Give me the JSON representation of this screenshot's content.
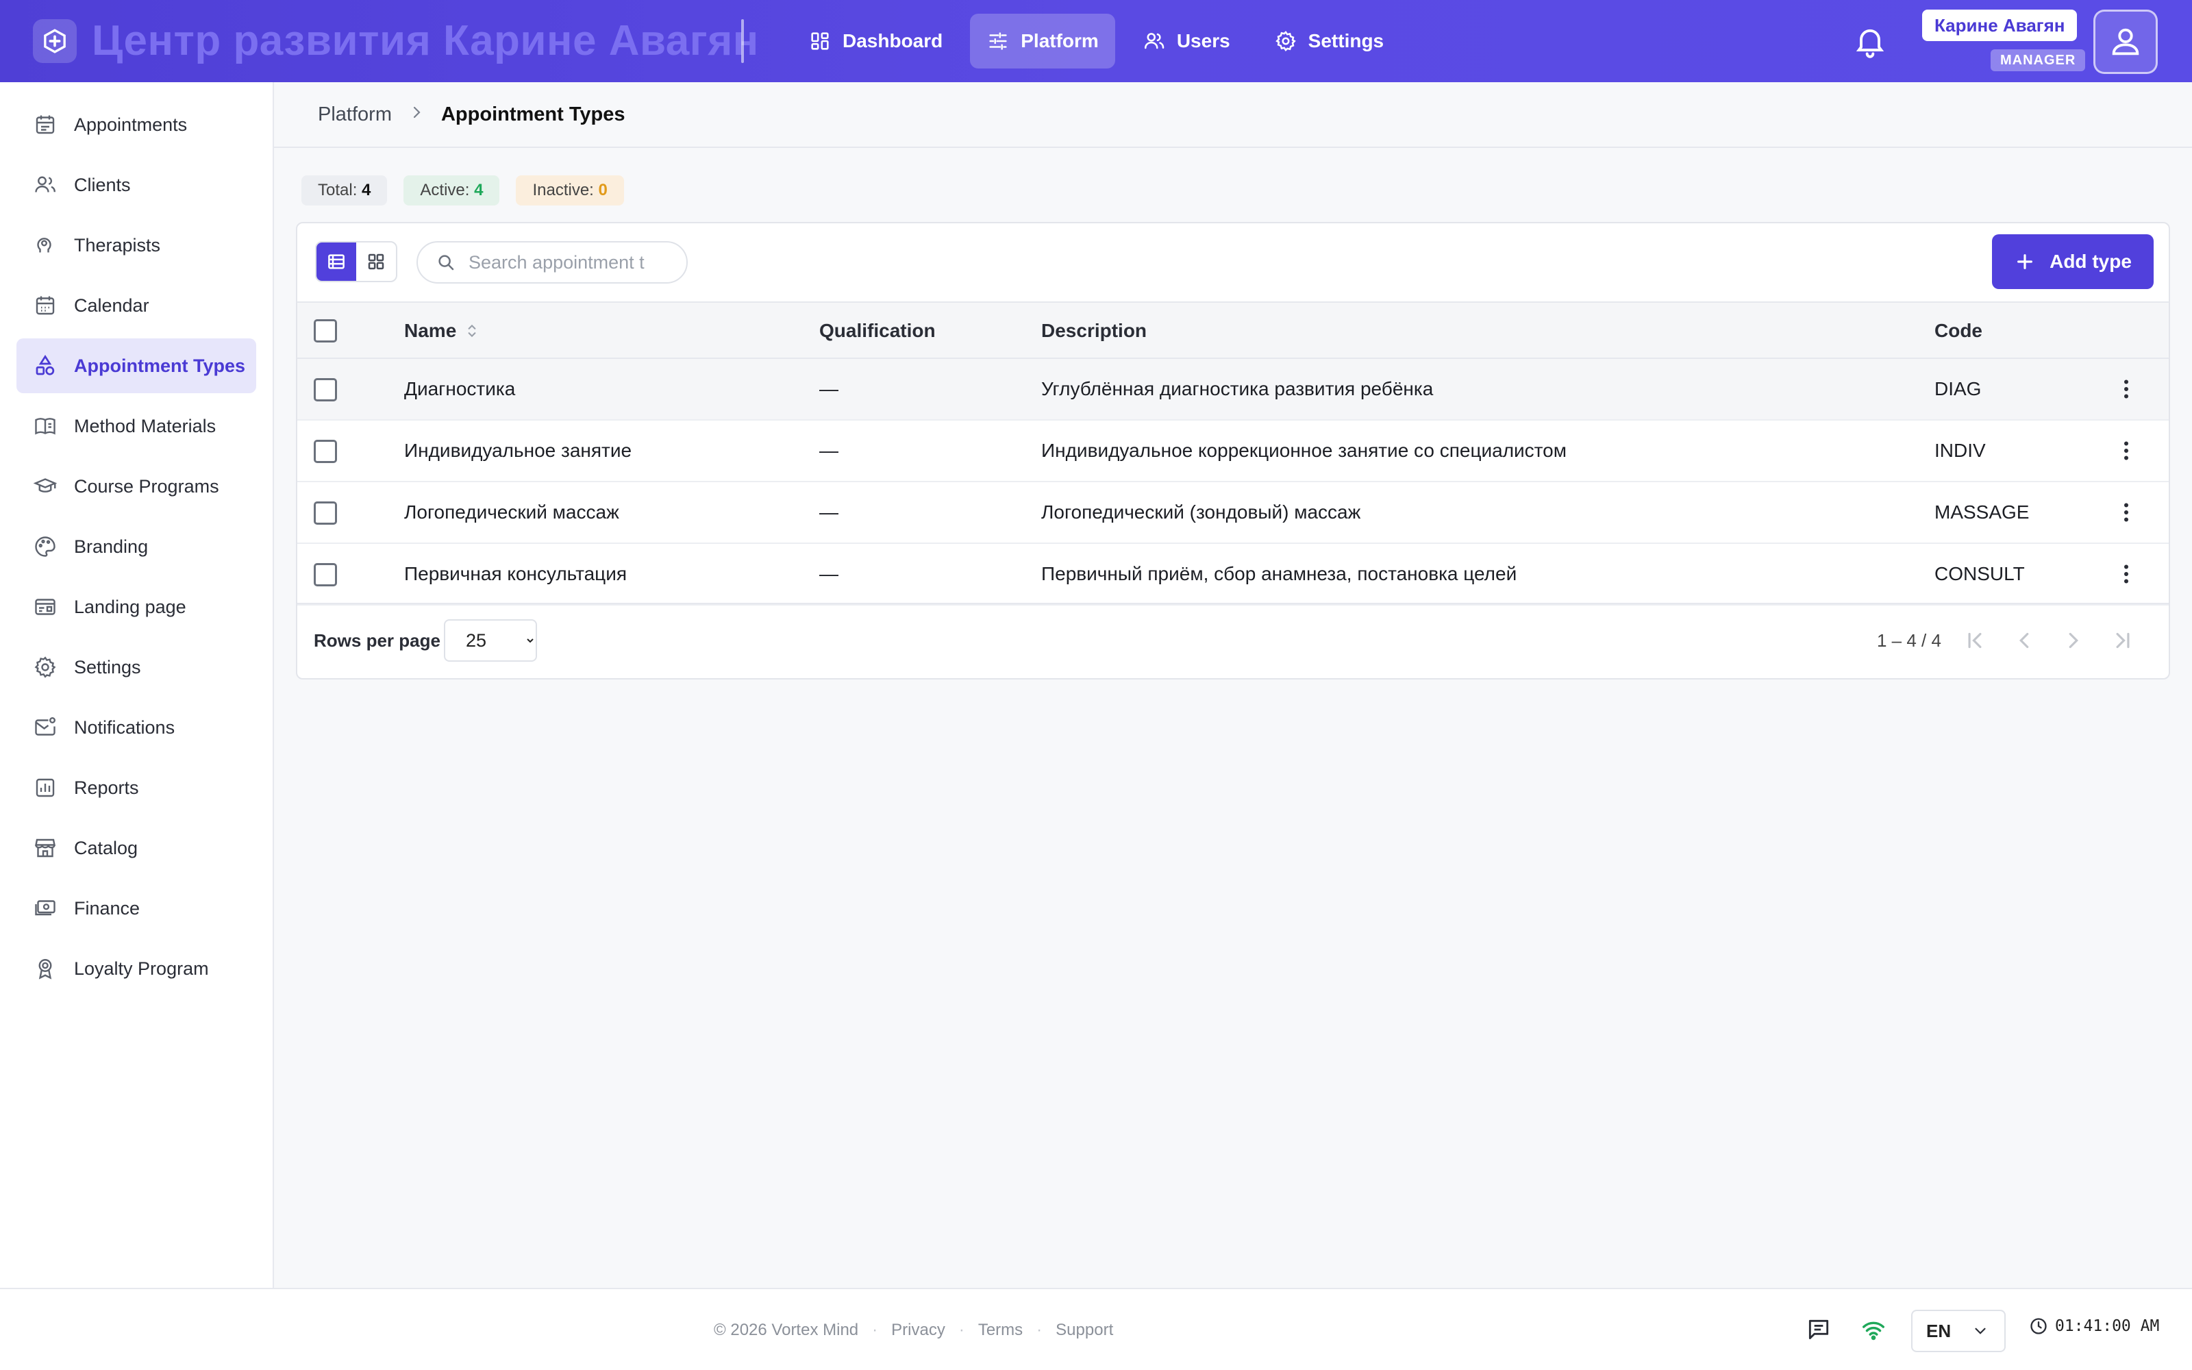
{
  "header": {
    "brand_title": "Центр развития Карине Авагян",
    "nav": [
      {
        "label": "Dashboard",
        "icon": "dashboard-icon"
      },
      {
        "label": "Platform",
        "icon": "sliders-icon",
        "active": true
      },
      {
        "label": "Users",
        "icon": "users-icon"
      },
      {
        "label": "Settings",
        "icon": "gear-icon"
      }
    ],
    "user_name": "Карине Авагян",
    "user_role": "MANAGER"
  },
  "sidebar": {
    "items": [
      {
        "label": "Appointments",
        "icon": "appointments-icon"
      },
      {
        "label": "Clients",
        "icon": "clients-icon"
      },
      {
        "label": "Therapists",
        "icon": "therapists-icon"
      },
      {
        "label": "Calendar",
        "icon": "calendar-icon"
      },
      {
        "label": "Appointment Types",
        "icon": "shapes-icon",
        "active": true
      },
      {
        "label": "Method Materials",
        "icon": "book-icon"
      },
      {
        "label": "Course Programs",
        "icon": "graduation-cap-icon"
      },
      {
        "label": "Branding",
        "icon": "palette-icon"
      },
      {
        "label": "Landing page",
        "icon": "landing-icon"
      },
      {
        "label": "Settings",
        "icon": "gear-icon"
      },
      {
        "label": "Notifications",
        "icon": "mail-icon"
      },
      {
        "label": "Reports",
        "icon": "reports-icon"
      },
      {
        "label": "Catalog",
        "icon": "store-icon"
      },
      {
        "label": "Finance",
        "icon": "money-icon"
      },
      {
        "label": "Loyalty Program",
        "icon": "award-icon"
      }
    ]
  },
  "breadcrumb": {
    "parent": "Platform",
    "current": "Appointment Types"
  },
  "stats": {
    "total_label": "Total:",
    "total_value": "4",
    "active_label": "Active:",
    "active_value": "4",
    "inactive_label": "Inactive:",
    "inactive_value": "0"
  },
  "toolbar": {
    "search_placeholder": "Search appointment t",
    "add_label": "Add type"
  },
  "table": {
    "columns": {
      "name": "Name",
      "qualification": "Qualification",
      "description": "Description",
      "code": "Code"
    },
    "rows": [
      {
        "name": "Диагностика",
        "qualification": "—",
        "description": "Углублённая диагностика развития ребёнка",
        "code": "DIAG"
      },
      {
        "name": "Индивидуальное занятие",
        "qualification": "—",
        "description": "Индивидуальное коррекционное занятие со специалистом",
        "code": "INDIV"
      },
      {
        "name": "Логопедический массаж",
        "qualification": "—",
        "description": "Логопедический (зондовый) массаж",
        "code": "MASSAGE"
      },
      {
        "name": "Первичная консультация",
        "qualification": "—",
        "description": "Первичный приём, сбор анамнеза, постановка целей",
        "code": "CONSULT"
      }
    ]
  },
  "pagination": {
    "rows_per_page_label": "Rows per page",
    "rows_per_page_value": "25",
    "range": "1 – 4 / 4"
  },
  "footer": {
    "copyright": "© 2026 Vortex Mind",
    "privacy": "Privacy",
    "terms": "Terms",
    "support": "Support",
    "language": "EN",
    "time": "01:41:00 AM"
  },
  "colors": {
    "accent": "#5140dc",
    "active_green": "#1fa85a",
    "inactive_orange": "#e19a1a"
  }
}
